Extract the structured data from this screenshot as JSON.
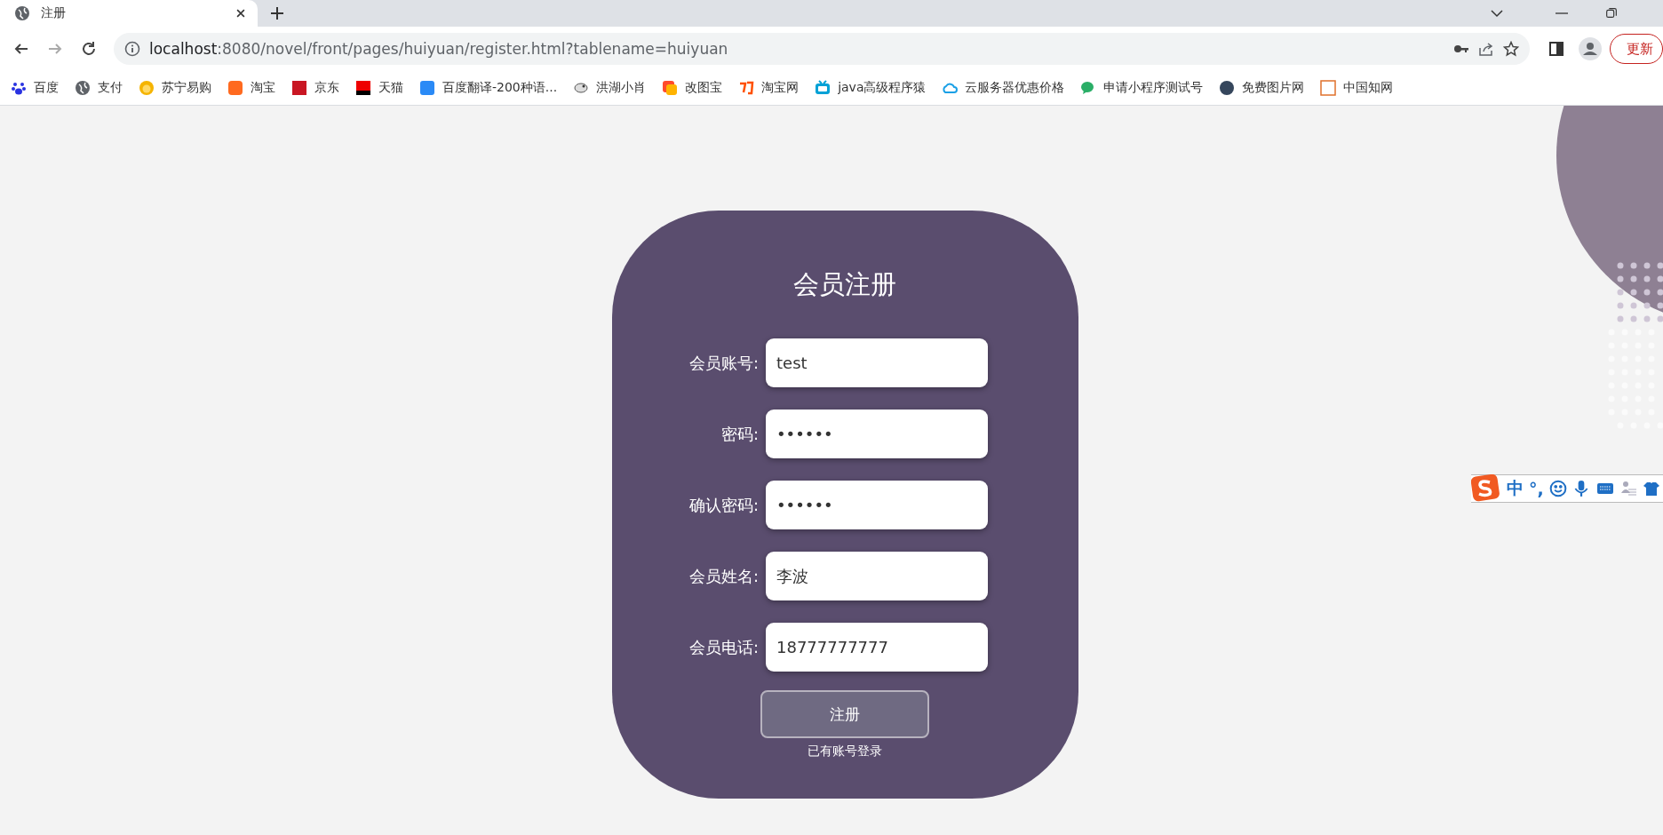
{
  "browser": {
    "tab": {
      "title": "注册",
      "selected": true
    },
    "url": {
      "host": "localhost",
      "rest": ":8080/novel/front/pages/huiyuan/register.html?tablename=huiyuan"
    },
    "update_button": "更新",
    "bookmarks": [
      {
        "label": "百度"
      },
      {
        "label": "支付"
      },
      {
        "label": "苏宁易购"
      },
      {
        "label": "淘宝"
      },
      {
        "label": "京东"
      },
      {
        "label": "天猫"
      },
      {
        "label": "百度翻译-200种语..."
      },
      {
        "label": "洪湖小肖"
      },
      {
        "label": "改图宝"
      },
      {
        "label": "淘宝网"
      },
      {
        "label": "java高级程序猿"
      },
      {
        "label": "云服务器优惠价格"
      },
      {
        "label": "申请小程序测试号"
      },
      {
        "label": "免费图片网"
      },
      {
        "label": "中国知网"
      }
    ]
  },
  "form": {
    "title": "会员注册",
    "fields": [
      {
        "label": "会员账号:",
        "value": "test"
      },
      {
        "label": "密码:",
        "value": "••••••"
      },
      {
        "label": "确认密码:",
        "value": "••••••"
      },
      {
        "label": "会员姓名:",
        "value": "李波"
      },
      {
        "label": "会员电话:",
        "value": "18777777777"
      }
    ],
    "submit": "注册",
    "login_link": "已有账号登录"
  },
  "ime_bar": {
    "mode": "中",
    "punctuation": "°,"
  }
}
